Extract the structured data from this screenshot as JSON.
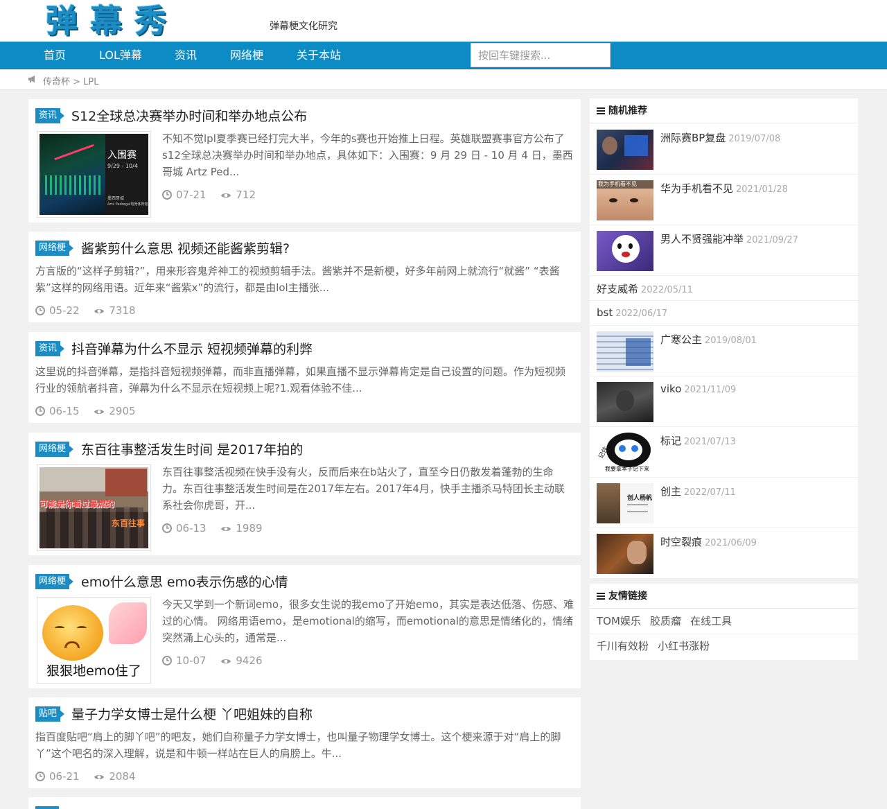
{
  "header": {
    "logo": "弹幕秀",
    "tagline": "弹幕梗文化研究"
  },
  "nav": {
    "items": [
      "首页",
      "LOL弹幕",
      "资讯",
      "网络梗",
      "关于本站"
    ],
    "search_placeholder": "按回车键搜索..."
  },
  "breadcrumb": {
    "text": "传奇杯 > LPL"
  },
  "thumb_text": {
    "a1_big": "入围赛",
    "a1_date": "9/29 - 10/4",
    "a1_city": "墨西哥城",
    "a1_venue": "Artz Pedregal电竞体育馆",
    "a4_line1": "可能是你看过最燃的",
    "a4_line2": "东百往事",
    "a5_caption": "狠狠地emo住了",
    "r2_caption": "我为手机看不见",
    "r8_caption": "我要拿本子记下来",
    "r8_side": "记住",
    "r9_title": "创人杨帆"
  },
  "articles": [
    {
      "tag": "资讯",
      "title": "S12全球总决赛举办时间和举办地点公布",
      "excerpt": "不知不觉lpl夏季赛已经打完大半，今年的s赛也开始推上日程。英雄联盟赛事官方公布了s12全球总决赛举办时间和举办地点，具体如下：入围赛：9 月 29 日 - 10 月 4 日，墨西哥城 Artz Ped...",
      "date": "07-21",
      "views": "712"
    },
    {
      "tag": "网络梗",
      "title": "酱紫剪什么意思 视频还能酱紫剪辑?",
      "excerpt": "方言版的“这样子剪辑?”，用来形容鬼斧神工的视频剪辑手法。酱紫并不是新梗，好多年前网上就流行“就酱” “表酱紫”这样的网络用语。近年来“酱紫x”的流行，都是由lol主播张...",
      "date": "05-22",
      "views": "7318"
    },
    {
      "tag": "资讯",
      "title": "抖音弹幕为什么不显示 短视频弹幕的利弊",
      "excerpt": "这里说的抖音弹幕，是指抖音短视频弹幕，而非直播弹幕，如果直播不显示弹幕肯定是自己设置的问题。作为短视频行业的领航者抖音，弹幕为什么不显示在短视频上呢?1.观看体验不佳...",
      "date": "06-15",
      "views": "2905"
    },
    {
      "tag": "网络梗",
      "title": "东百往事整活发生时间 是2017年拍的",
      "excerpt": "东百往事整活视频在快手没有火，反而后来在b站火了，直至今日仍散发着蓬勃的生命力。东百往事整活发生时间是在2017年左右。2017年4月，快手主播杀马特团长主动联系社会你虎哥，开...",
      "date": "06-13",
      "views": "1989"
    },
    {
      "tag": "网络梗",
      "title": "emo什么意思 emo表示伤感的心情",
      "excerpt": "今天又学到一个新词emo，很多女生说的我emo了开始emo，其实是表达低落、伤感、难过的心情。 网络用语emo，是emotional的缩写，而emotional的意思是情绪化的，情绪突然涌上心头的，通常是...",
      "date": "10-07",
      "views": "9426"
    },
    {
      "tag": "贴吧",
      "title": "量子力学女博士是什么梗 丫吧姐妹的自称",
      "excerpt": "指百度贴吧“肩上的脚丫吧”的吧友，她们自称量子力学女博士，也叫量子物理学女博士。这个梗来源于对“肩上的脚丫”这个吧名的深入理解，说是和牛顿一样站在巨人的肩膀上。牛...",
      "date": "06-21",
      "views": "2084"
    }
  ],
  "sidebar": {
    "random_title": "随机推荐",
    "random": [
      {
        "title": "洲际赛BP复盘",
        "date": "2019/07/08"
      },
      {
        "title": "华为手机看不见",
        "date": "2021/01/28"
      },
      {
        "title": "男人不贤强能冲举",
        "date": "2021/09/27"
      },
      {
        "title": "好支威希",
        "date": "2022/05/11"
      },
      {
        "title": "bst",
        "date": "2022/06/17"
      },
      {
        "title": "广寒公主",
        "date": "2019/08/01"
      },
      {
        "title": "viko",
        "date": "2021/11/09"
      },
      {
        "title": "标记",
        "date": "2021/07/13"
      },
      {
        "title": "创主",
        "date": "2022/07/11"
      },
      {
        "title": "时空裂痕",
        "date": "2021/06/09"
      }
    ],
    "links_title": "友情链接",
    "links_row1": [
      "TOM娱乐",
      "胶质瘤",
      "在线工具"
    ],
    "links_row2": [
      "千川有效粉",
      "小红书涨粉"
    ]
  },
  "colors": {
    "brand": "#0d8bc5",
    "tag": "#1b8cc4"
  }
}
